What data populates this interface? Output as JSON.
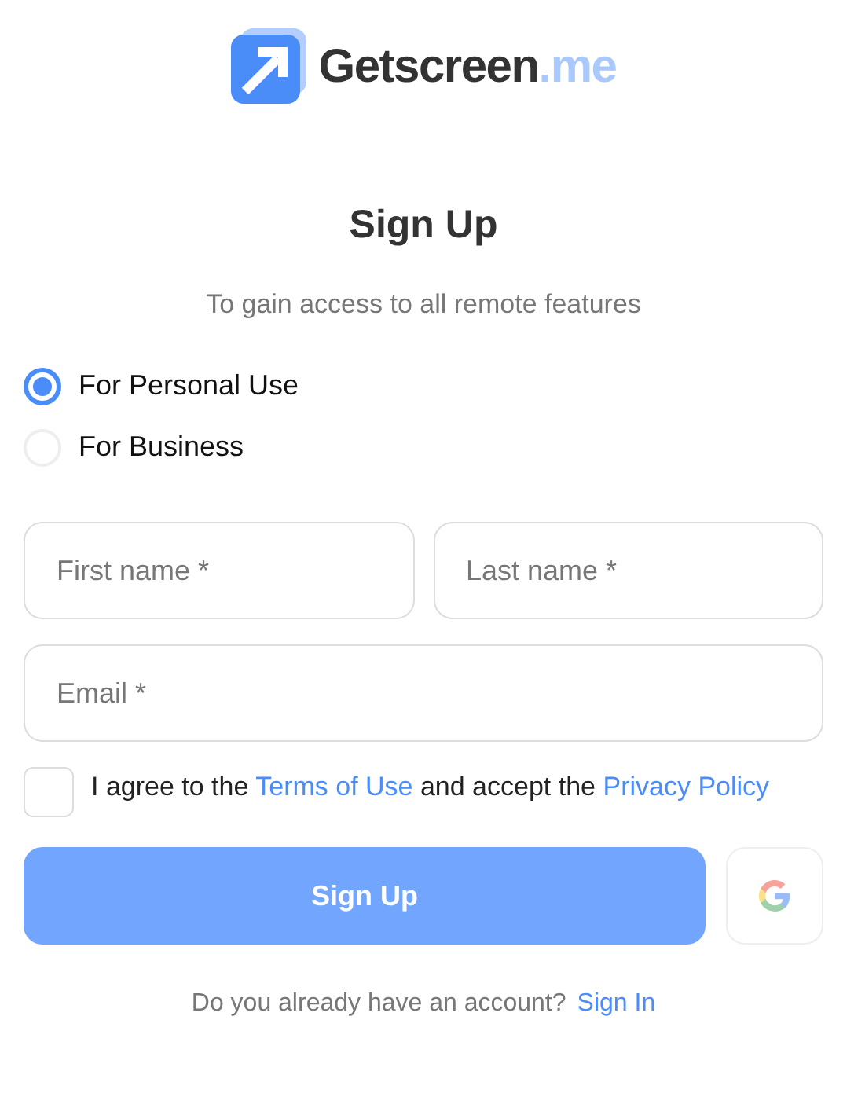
{
  "logo": {
    "name": "Getscreen",
    "suffix": ".me"
  },
  "title": "Sign Up",
  "subtitle": "To gain access to all remote features",
  "usage_options": [
    {
      "label": "For Personal Use",
      "selected": true
    },
    {
      "label": "For Business",
      "selected": false
    }
  ],
  "fields": [
    {
      "placeholder": "First name *",
      "kind": "half"
    },
    {
      "placeholder": "Last name *",
      "kind": "half"
    },
    {
      "placeholder": "Email *",
      "kind": "full"
    }
  ],
  "agreement": {
    "checked": false,
    "parts": [
      {
        "kind": "text",
        "text": "I agree to the "
      },
      {
        "kind": "link",
        "text": "Terms of Use"
      },
      {
        "kind": "text",
        "text": " and accept the "
      },
      {
        "kind": "link",
        "text": "Privacy Policy"
      }
    ]
  },
  "submit_button": "Sign Up",
  "footer": {
    "question": "Do you already have an account?",
    "link": "Sign In"
  }
}
